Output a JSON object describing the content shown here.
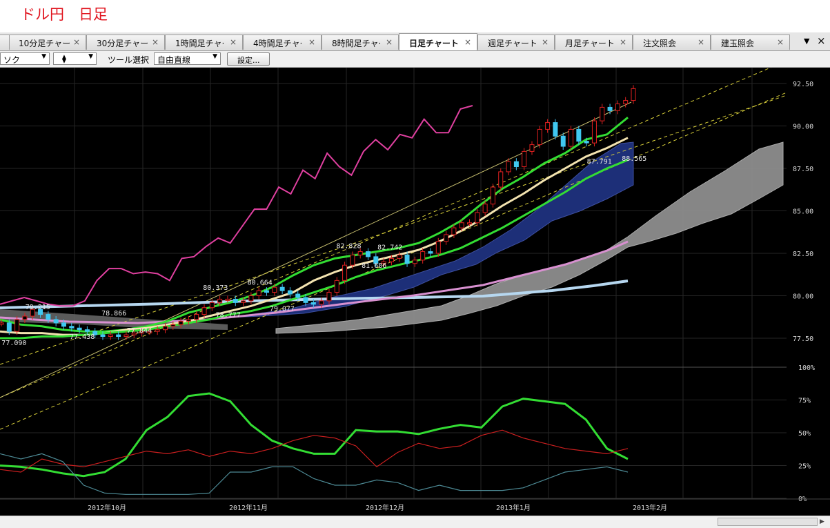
{
  "title": "ドル円　日足",
  "tabs": [
    {
      "label": "10分足チャー"
    },
    {
      "label": "30分足チャー"
    },
    {
      "label": "1時間足チャ·"
    },
    {
      "label": "4時間足チャ·"
    },
    {
      "label": "8時間足チャ·"
    },
    {
      "label": "日足チャート"
    },
    {
      "label": "週足チャート"
    },
    {
      "label": "月足チャート"
    },
    {
      "label": "注文照会"
    },
    {
      "label": "建玉照会"
    }
  ],
  "active_tab_index": 5,
  "tab_close_glyph": "×",
  "tab_menu_glyph": "▼",
  "window_close_glyph": "×",
  "toolbar": {
    "chart_type_value": "ソク",
    "marker_value": "⧫",
    "tool_label": "ツール選択",
    "tool_value": "自由直線",
    "settings_label": "設定..."
  },
  "chart_data": [
    {
      "type": "candlestick",
      "x_axis_labels": [
        "2012年10月",
        "2012年11月",
        "2012年12月",
        "2013年1月",
        "2013年2月"
      ],
      "y_axis_labels": [
        "92.50",
        "90.00",
        "87.50",
        "85.00",
        "82.50",
        "80.00",
        "77.50"
      ],
      "ylim": [
        76.3,
        93.5
      ],
      "annotations": [
        {
          "text": "77.090",
          "x": 0.5,
          "y": 77.09
        },
        {
          "text": "79.215",
          "x": 8,
          "y": 79.2
        },
        {
          "text": "77.438",
          "x": 22,
          "y": 77.45
        },
        {
          "text": "78.866",
          "x": 32,
          "y": 78.85
        },
        {
          "text": "77.844",
          "x": 40,
          "y": 77.82
        },
        {
          "text": "80.373",
          "x": 64,
          "y": 80.35
        },
        {
          "text": "78.777",
          "x": 68,
          "y": 78.75
        },
        {
          "text": "80.664",
          "x": 78,
          "y": 80.65
        },
        {
          "text": "79.077",
          "x": 85,
          "y": 79.1
        },
        {
          "text": "82.828",
          "x": 106,
          "y": 82.8
        },
        {
          "text": "82.742",
          "x": 119,
          "y": 82.72
        },
        {
          "text": "81.686",
          "x": 114,
          "y": 81.65
        },
        {
          "text": "87.791",
          "x": 185,
          "y": 87.78
        },
        {
          "text": "88.565",
          "x": 196,
          "y": 87.95
        }
      ],
      "series": [
        {
          "name": "",
          "kind": "price",
          "values": [
            78.4,
            77.9,
            78.6,
            78.8,
            79.2,
            78.9,
            78.6,
            78.4,
            78.2,
            78.1,
            78.0,
            77.9,
            77.7,
            77.6,
            77.7,
            77.6,
            77.7,
            77.8,
            77.9,
            77.9,
            78.0,
            78.2,
            78.3,
            78.5,
            78.6,
            78.9,
            79.3,
            79.6,
            79.8,
            79.8,
            79.6,
            79.7,
            80.0,
            80.3,
            80.2,
            80.5,
            80.3,
            80.1,
            79.9,
            79.6,
            79.5,
            79.7,
            80.2,
            80.9,
            81.8,
            82.4,
            82.6,
            82.3,
            81.9,
            82.0,
            82.2,
            82.4,
            81.9,
            82.1,
            82.6,
            82.5,
            83.2,
            83.6,
            84.0,
            84.3,
            84.3,
            84.9,
            85.4,
            86.4,
            87.3,
            87.9,
            87.6,
            88.5,
            88.9,
            89.8,
            90.2,
            89.4,
            88.8,
            89.8,
            89.1,
            89.0,
            90.3,
            91.1,
            90.9,
            91.3,
            91.5,
            92.2
          ]
        },
        {
          "name": "",
          "kind": "ma-short",
          "values": [
            78.6,
            78.3,
            78.2,
            78.0,
            77.9,
            77.9,
            78.0,
            78.2,
            78.5,
            79.0,
            79.3,
            79.6,
            80.0,
            80.5,
            81.2,
            81.8,
            82.2,
            82.4,
            82.6,
            82.8,
            83.1,
            83.7,
            84.4,
            85.4,
            86.3,
            87.0,
            87.8,
            88.4,
            89.2,
            89.5,
            90.5
          ]
        },
        {
          "name": "",
          "kind": "ma-mid",
          "values": [
            77.9,
            77.8,
            77.8,
            77.7,
            77.7,
            77.8,
            78.0,
            78.1,
            78.3,
            78.5,
            78.8,
            79.1,
            79.4,
            79.8,
            80.2,
            80.9,
            81.4,
            81.8,
            82.1,
            82.4,
            82.7,
            83.2,
            83.8,
            84.5,
            85.3,
            86.0,
            86.8,
            87.5,
            88.2,
            88.7,
            89.3
          ]
        },
        {
          "name": "",
          "kind": "ma-long",
          "values": [
            77.5,
            77.5,
            77.6,
            77.6,
            77.7,
            77.8,
            77.9,
            78.0,
            78.2,
            78.4,
            78.6,
            78.9,
            79.1,
            79.4,
            79.8,
            80.2,
            80.6,
            81.1,
            81.5,
            81.8,
            82.1,
            82.4,
            82.8,
            83.4,
            84.0,
            84.7,
            85.4,
            86.1,
            86.9,
            87.5,
            88.0
          ]
        },
        {
          "name": "",
          "kind": "rci-line",
          "values": [
            79.5,
            79.7,
            79.9,
            79.7,
            79.5,
            79.4,
            79.4,
            79.7,
            80.9,
            81.6,
            81.6,
            81.3,
            81.4,
            81.3,
            80.9,
            82.2,
            82.3,
            82.9,
            83.4,
            83.1,
            84.1,
            85.1,
            85.1,
            86.4,
            86.0,
            87.4,
            86.9,
            88.4,
            87.6,
            87.1,
            88.5,
            89.2,
            88.6,
            89.5,
            89.3,
            90.4,
            89.6,
            89.6,
            91.0,
            91.2
          ]
        }
      ]
    },
    {
      "type": "line",
      "y_axis_labels": [
        "100%",
        "75%",
        "50%",
        "25%",
        "0%"
      ],
      "ylim": [
        0,
        100
      ],
      "series": [
        {
          "name": "",
          "color": "#33dd33",
          "values": [
            25,
            24,
            22,
            19,
            17,
            20,
            30,
            52,
            62,
            78,
            80,
            74,
            56,
            44,
            38,
            34,
            34,
            52,
            51,
            51,
            49,
            53,
            56,
            54,
            70,
            76,
            74,
            72,
            60,
            38,
            30
          ]
        },
        {
          "name": "",
          "color": "#cc1f1f",
          "values": [
            22,
            20,
            30,
            26,
            24,
            28,
            32,
            36,
            34,
            37,
            32,
            36,
            34,
            38,
            44,
            48,
            46,
            40,
            24,
            35,
            42,
            38,
            40,
            48,
            52,
            46,
            42,
            38,
            36,
            34,
            38
          ]
        },
        {
          "name": "",
          "color": "#4d8a95",
          "values": [
            34,
            30,
            34,
            28,
            10,
            4,
            3,
            3,
            3,
            3,
            4,
            20,
            20,
            24,
            24,
            15,
            10,
            10,
            14,
            12,
            6,
            10,
            6,
            6,
            6,
            8,
            14,
            20,
            22,
            24,
            20
          ]
        }
      ]
    }
  ]
}
